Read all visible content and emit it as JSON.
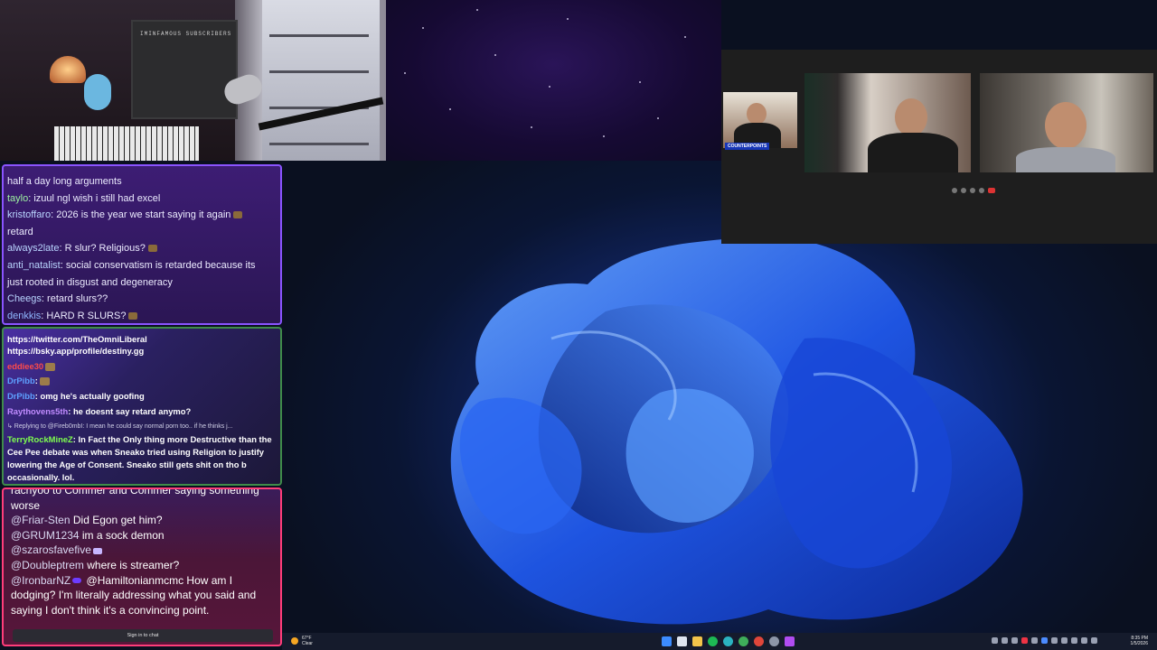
{
  "webcam": {
    "poster_text": "IMINFAMOUS SUBSCRIBERS"
  },
  "call": {
    "badge": "COUNTERPOINTS"
  },
  "chat_top": {
    "messages": [
      {
        "user": "",
        "text": "half a day long arguments"
      },
      {
        "user": "taylo",
        "text": ": izuul ngl wish i still had excel"
      },
      {
        "user": "kristoffaro",
        "text": ": 2026 is the year we start saying it again"
      },
      {
        "user": "",
        "text": "retard"
      },
      {
        "user": "always2late",
        "text": ": R slur? Religious?"
      },
      {
        "user": "anti_natalist",
        "text": ": social conservatism is retarded because its"
      },
      {
        "user": "",
        "text": "just rooted in disgust and degeneracy"
      },
      {
        "user": "Cheegs",
        "text": ": retard slurs??"
      },
      {
        "user": "denkkis",
        "text": ": HARD R SLURS?"
      }
    ]
  },
  "chat_mid": {
    "link1": "https://twitter.com/TheOmniLiberal",
    "link2": "https://bsky.app/profile/destiny.gg",
    "u1": "eddiee30",
    "u2": "DrPibb",
    "u2_text": ":",
    "u3": "DrPibb",
    "u3_text": ": omg he's actually goofing",
    "u4": "Raythovens5th",
    "u4_text": ": he doesnt say retard anymo?",
    "reply": "↳ Replying to @Fireb0mbI: I mean he could say normal porn too.. if he thinks j...",
    "u5": "TerryRockMineZ",
    "u5_text": ": In Fact the Only thing more Destructive than the Cee Pee debate was when Sneako tried using Religion to justify lowering the Age of Consent. Sneako still gets shit on tho b occasionally. lol."
  },
  "chat_bottom": {
    "cut_line": "rachyoo to Commer and Commer saying something",
    "line0": "worse",
    "m1_user": "@Friar-Sten",
    "m1_text": " Did Egon get him?",
    "m2_user": "@GRUM1234",
    "m2_text": " im a sock demon",
    "m3_user": "@szarosfavefive",
    "m4_user": "@Doubleptrem",
    "m4_text": " where is streamer?",
    "m5_user": "@IronbarNZ",
    "m5_text": " @Hamiltonianmcmc How am I dodging? I'm literally addressing what you said and saying I don't think it's a convincing point.",
    "signin": "Sign in to chat"
  },
  "taskbar": {
    "weather_temp": "67°F",
    "weather_desc": "Clear",
    "time": "8:35 PM",
    "date": "1/5/2026"
  }
}
